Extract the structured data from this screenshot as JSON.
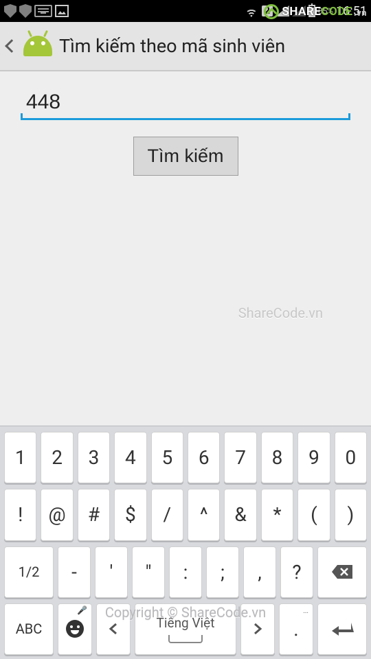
{
  "status_bar": {
    "sim_label": "2",
    "battery_pct": "85%",
    "clock": "16:51"
  },
  "action_bar": {
    "title": "Tìm kiếm theo mã sinh viên"
  },
  "search": {
    "value": "448",
    "button_label": "Tìm kiếm"
  },
  "watermarks": {
    "center": "ShareCode.vn",
    "bottom": "Copyright © ShareCode.vn",
    "logo_text_1": "SHARE",
    "logo_text_2": "CODE",
    "logo_text_3": ".vn"
  },
  "keyboard": {
    "row1": [
      "1",
      "2",
      "3",
      "4",
      "5",
      "6",
      "7",
      "8",
      "9",
      "0"
    ],
    "row2": [
      "!",
      "@",
      "#",
      "$",
      "/",
      "^",
      "&",
      "*",
      "(",
      ")"
    ],
    "row3": {
      "toggle": "1/2",
      "keys": [
        "-",
        "'",
        "\"",
        ":",
        ";",
        ",",
        "?"
      ]
    },
    "row4": {
      "abc": "ABC",
      "space_label": "Tiếng Việt",
      "dot": ".",
      "dot_sup": "…"
    }
  }
}
